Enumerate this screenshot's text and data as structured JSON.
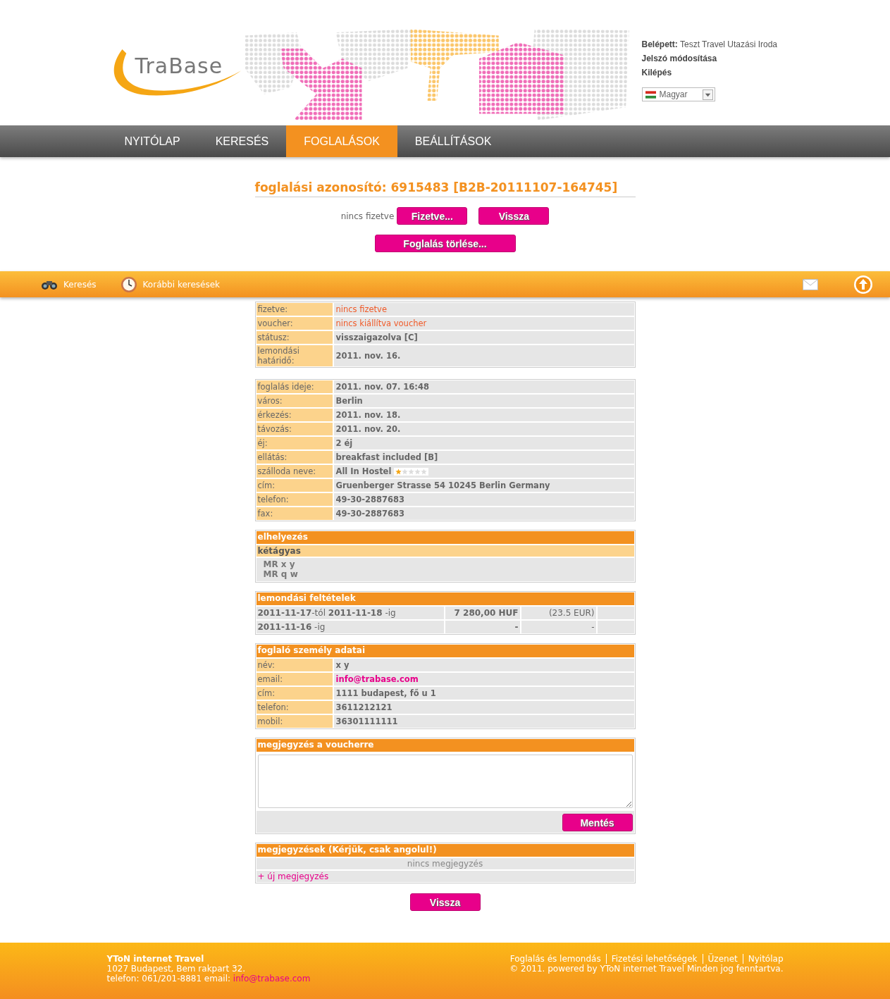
{
  "header": {
    "logo": "TraBase",
    "user_label": "Belépett:",
    "user_name": "Teszt Travel Utazási Iroda",
    "links": [
      "Jelszó módosítása",
      "Kilépés"
    ],
    "language": "Magyar"
  },
  "nav": [
    {
      "label": "NYITÓLAP",
      "selected": false
    },
    {
      "label": "KERESÉS",
      "selected": false
    },
    {
      "label": "FOGLALÁSOK",
      "selected": true
    },
    {
      "label": "BEÁLLÍTÁSOK",
      "selected": false
    }
  ],
  "toolbar": {
    "items": [
      "Keresés",
      "Korábbi keresések"
    ]
  },
  "booking": {
    "title": "foglalási azonosító: 6915483 [B2B-20111107-164745]",
    "payment_status": "nincs fizetve",
    "buttons": [
      "Fizetve...",
      "Vissza"
    ],
    "delete_button": "Foglalás törlése..."
  },
  "status_table": [
    {
      "label": "fizetve:",
      "value": "nincs fizetve",
      "kind": "alert"
    },
    {
      "label": "voucher:",
      "value": "nincs kiállítva voucher",
      "kind": "alert"
    },
    {
      "label": "státusz:",
      "value": "visszaigazolva [C]",
      "kind": "text"
    },
    {
      "label": "lemondási határidő:",
      "value": "2011. nov. 16.",
      "kind": "text"
    }
  ],
  "details_table": [
    {
      "label": "foglalás ideje:",
      "value": "2011. nov. 07. 16:48",
      "kind": "text"
    },
    {
      "label": "város:",
      "value": "Berlin",
      "kind": "text"
    },
    {
      "label": "érkezés:",
      "value": "2011. nov. 18.",
      "kind": "text"
    },
    {
      "label": "távozás:",
      "value": "2011. nov. 20.",
      "kind": "text"
    },
    {
      "label": "éj:",
      "value": "2 éj",
      "kind": "text"
    },
    {
      "label": "ellátás:",
      "value": "breakfast included [B]",
      "kind": "text"
    },
    {
      "label": "szálloda neve:",
      "value": "All In Hostel",
      "kind": "hotel",
      "stars": 1
    },
    {
      "label": "cím:",
      "value": "Gruenberger Strasse 54 10245 Berlin Germany",
      "kind": "text"
    },
    {
      "label": "telefon:",
      "value": "49-30-2887683",
      "kind": "text"
    },
    {
      "label": "fax:",
      "value": "49-30-2887683",
      "kind": "text"
    }
  ],
  "accommodation": {
    "title": "elhelyezés",
    "room_type": "kétágyas",
    "guests": [
      "MR x y",
      "MR q w"
    ]
  },
  "cancellation": {
    "title": "lemondási feltételek",
    "rows": [
      {
        "period": "**2011-11-17**-tól **2011-11-18** -ig",
        "huf": "7 280,00 HUF",
        "eur": "(23.5 EUR)"
      },
      {
        "period": "**2011-11-16** -ig",
        "huf": "-",
        "eur": "-"
      }
    ]
  },
  "customer": {
    "title": "foglaló személy adatai",
    "rows": [
      {
        "label": "név:",
        "value": "x y",
        "kind": "text"
      },
      {
        "label": "email:",
        "value": "info@trabase.com",
        "kind": "link"
      },
      {
        "label": "cím:",
        "value": "1111 budapest, fő u 1",
        "kind": "text"
      },
      {
        "label": "telefon:",
        "value": "3611212121",
        "kind": "text"
      },
      {
        "label": "mobil:",
        "value": "36301111111",
        "kind": "text"
      }
    ]
  },
  "voucher_note": {
    "title": "megjegyzés a voucherre",
    "button": "Mentés"
  },
  "notes": {
    "title": "megjegyzések (Kérjük, csak angolul!)",
    "empty": "nincs megjegyzés",
    "add_link": "+ új megjegyzés"
  },
  "back_button": "Vissza",
  "footer": {
    "company": "YToN internet Travel",
    "address": "1027 Budapest, Bem rakpart 32.",
    "contact": "telefon: 061/201-8881 email:",
    "email": "info@trabase.com",
    "links": [
      "Foglalás és lemondás",
      "Fizetési lehetőségek",
      "Üzenet",
      "Nyitólap"
    ],
    "copyright": "© 2011. powered by YToN internet Travel Minden jog fenntartva."
  }
}
